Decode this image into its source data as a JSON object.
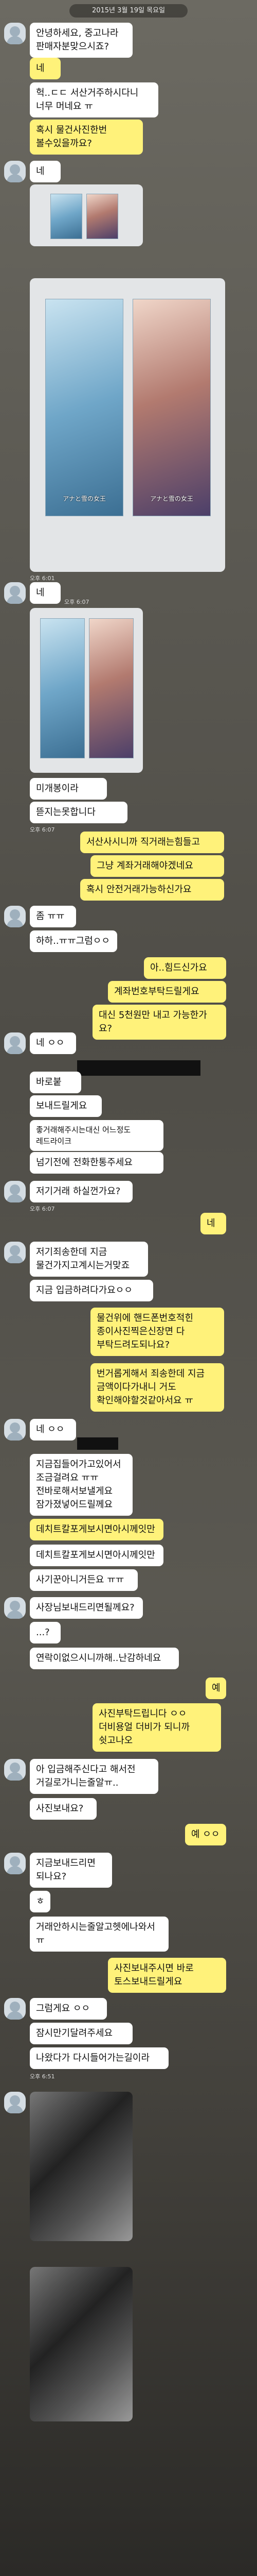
{
  "date": "2015년 3월 19일 목요일",
  "posters": {
    "left": "アナと雪の女王",
    "right": "アナと雪の女王"
  },
  "messages": {
    "m1": "안녕하세요, 중고나라\n판매자분맞으시죠?",
    "m2": "네",
    "m3": "헉..ㄷㄷ 서산거주하시다니\n너무 머네요 ㅠ",
    "m4": "혹시 물건사진한번\n볼수있을까요?",
    "m5": "네",
    "t5": "오후 6:01",
    "m6": "네",
    "t6": "오후 6:07",
    "m7": "미개봉이라",
    "m8": "뜯지는못합니다",
    "t8": "오후 6:07",
    "m9": "서산사시니까 직거래는힘들고",
    "m10": "그냥 계좌거래해야겠네요",
    "m11": "혹시 안전거래가능하신가요",
    "m12": "좀 ㅠㅠ",
    "m13": "하하..ㅠㅠ그럼ㅇㅇ",
    "m14": "아..힘드신가요",
    "m15": "계좌번호부탁드릴게요",
    "m16": "대신 5천원만 내고 가능한가요?",
    "m17": "네 ㅇㅇ",
    "m18": "바로붙",
    "m19": "보내드릴게요",
    "m20": "좋거래해주시는대신 어느정도\n레드라이크",
    "m21": "넘기전에 전화한통주세요",
    "m22": "저기거래 하실껀가요?",
    "m23": "네",
    "m24": "저기죄송한데 지금\n물건가지고계시는거맞죠",
    "m25": "지금 입금하려다가요ㅇㅇ",
    "m26": "물건위에 핸드폰번호적힌\n종이사진찍은신장면 다\n부탁드려도되나요?",
    "m27": "번거롭게해서 죄송한데 지금\n금액이다가내니 거도\n확인해야할것같아서요 ㅠ",
    "m28": "네 ㅇㅇ",
    "m29": "지금집들어가고있어서\n조금걸려요 ㅠㅠ\n전바로해서보낼게요\n잠가졌넣어드릴께요",
    "m30": "데치트칼포게보시면아시께잇만",
    "m31": "데치트칼포게보시면아시께잇만",
    "m32": "사기꾼아니거든요 ㅠㅠ",
    "m33": "사장님보내드리면될께요?",
    "m34": "...?",
    "m35": "연락이없으시니까해..난감하네요",
    "m36": "예",
    "m37": "사진부탁드립니다 ㅇㅇ\n더비용얼 더비가 되니까\n쉿고나오",
    "m38": "아 입금해주신다고 해서전\n거길로가니는줄알ㅠ..",
    "m39": "사진보내요?",
    "m40": "예 ㅇㅇ",
    "m41": "지금보내드리면\n되나요?",
    "m42": "ㅎ",
    "m43": "거래안하시는줄알고헷에나와서\nㅠ",
    "m44": "사진보내주시면 바로\n토스보내드릴게요",
    "m45": "그럼게요 ㅇㅇ",
    "m46": "잠시만기달려주세요",
    "m47": "나왔다가 다시들어가는길이라",
    "tgen": "오후 6:07",
    "tgen2": "오후 6:12",
    "tgen3": "오후 6:22",
    "tgen4": "오후 6:51"
  }
}
